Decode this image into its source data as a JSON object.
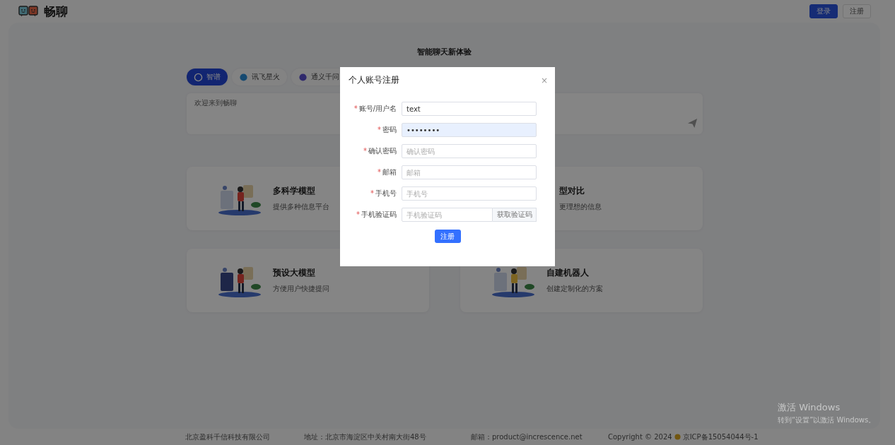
{
  "header": {
    "brand": "畅聊",
    "buttons": [
      {
        "label": "登录",
        "kind": "primary"
      },
      {
        "label": "注册",
        "kind": "plain"
      }
    ]
  },
  "hero": {
    "title": "智能聊天新体验",
    "models": [
      {
        "label": "智谱",
        "selected": true
      },
      {
        "label": "讯飞星火",
        "selected": false
      },
      {
        "label": "通义千问",
        "selected": false
      }
    ],
    "chat_input": {
      "placeholder": "欢迎来到畅聊"
    }
  },
  "cards": [
    {
      "title": "多科学模型",
      "subtitle": "提供多种信息平台",
      "kind": "picture",
      "covered": false
    },
    {
      "title": "型对比",
      "subtitle": "更理想的信息",
      "kind": "picture",
      "covered": true
    },
    {
      "title": "预设大模型",
      "subtitle": "方便用户快捷提问",
      "kind": "picture",
      "covered": false
    },
    {
      "title": "自建机器人",
      "subtitle": "创建定制化的方案",
      "kind": "picture",
      "covered": false
    }
  ],
  "footer": {
    "company": "北京盈科千信科技有限公司",
    "address": "地址：北京市海淀区中关村南大街48号",
    "email": "邮箱：product@increscence.net",
    "copyright": "Copyright © 2024",
    "icp": "京ICP备15054044号-1"
  },
  "dialog": {
    "title": "个人账号注册",
    "close": "×",
    "fields": [
      {
        "label": "账号/用户名",
        "required_mark": "*",
        "value": "text",
        "kind": "text",
        "autofilled": false
      },
      {
        "label": "密码",
        "required_mark": "*",
        "value": "••••••••",
        "kind": "text",
        "autofilled": true
      },
      {
        "label": "确认密码",
        "required_mark": "*",
        "placeholder": "确认密码",
        "kind": "text",
        "autofilled": false
      },
      {
        "label": "邮箱",
        "required_mark": "*",
        "placeholder": "邮箱",
        "kind": "text",
        "autofilled": false
      },
      {
        "label": "手机号",
        "required_mark": "*",
        "placeholder": "手机号",
        "kind": "text",
        "autofilled": false
      },
      {
        "label": "手机验证码",
        "required_mark": "*",
        "placeholder": "手机验证码",
        "kind": "code",
        "button": "获取验证码",
        "autofilled": false
      }
    ],
    "submit": "注册"
  },
  "os_notice": {
    "title": "激活 Windows",
    "text": "转到“设置”以激活 Windows。"
  }
}
